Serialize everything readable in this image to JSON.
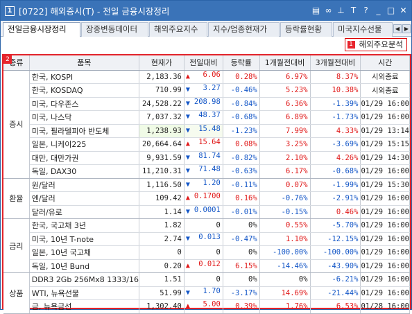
{
  "window": {
    "number": "1",
    "title": "[0722] 해외증시(T) - 전일 금융시장정리",
    "icons": [
      "window-list-icon",
      "link-icon",
      "pin-icon",
      "text-size-icon",
      "help-icon",
      "minimize-icon",
      "maximize-icon",
      "close-icon"
    ],
    "icon_glyphs": [
      "▤",
      "∞",
      "⊥",
      "T",
      "?",
      "_",
      "□",
      "✕"
    ]
  },
  "tabs": [
    {
      "label": "전일금융시장정리",
      "active": true
    },
    {
      "label": "장중변동데이터",
      "active": false
    },
    {
      "label": "해외주요지수",
      "active": false
    },
    {
      "label": "지수/업종현재가",
      "active": false
    },
    {
      "label": "등락률현황",
      "active": false
    },
    {
      "label": "미국지수선물",
      "active": false
    }
  ],
  "tab_arrows": {
    "left": "◀",
    "right": "▶"
  },
  "analysis_button": {
    "badge": "1",
    "label": "해외주요분석"
  },
  "grid_badge": "2",
  "columns": [
    "종류",
    "품목",
    "현재가",
    "전일대비",
    "등락률",
    "1개월전대비",
    "3개월전대비",
    "시간"
  ],
  "colors": {
    "up": "#e01818",
    "down": "#1356c7",
    "title_bar": "#3a73b8",
    "highlight_border": "#e2232b"
  },
  "groups": [
    {
      "category": "증시",
      "rows": [
        {
          "name": "한국, KOSPI",
          "price": "2,183.36",
          "dir": "up",
          "change": "6.06",
          "rate": "0.28%",
          "rate_dir": "up",
          "m1": "6.97%",
          "m1_dir": "up",
          "m3": "8.37%",
          "m3_dir": "up",
          "time": "시외종료"
        },
        {
          "name": "한국, KOSDAQ",
          "price": "710.99",
          "dir": "dn",
          "change": "3.27",
          "rate": "-0.46%",
          "rate_dir": "dn",
          "m1": "5.23%",
          "m1_dir": "up",
          "m3": "10.38%",
          "m3_dir": "up",
          "time": "시외종료"
        },
        {
          "name": "미국, 다우존스",
          "price": "24,528.22",
          "dir": "dn",
          "change": "208.98",
          "rate": "-0.84%",
          "rate_dir": "dn",
          "m1": "6.36%",
          "m1_dir": "up",
          "m3": "-1.39%",
          "m3_dir": "dn",
          "time": "01/29 16:00"
        },
        {
          "name": "미국, 나스닥",
          "price": "7,037.32",
          "dir": "dn",
          "change": "48.37",
          "rate": "-0.68%",
          "rate_dir": "dn",
          "m1": "6.89%",
          "m1_dir": "up",
          "m3": "-1.73%",
          "m3_dir": "dn",
          "time": "01/29 16:00"
        },
        {
          "name": "미국, 필라델피아 반도체",
          "price": "1,238.93",
          "dir": "dn",
          "change": "15.48",
          "rate": "-1.23%",
          "rate_dir": "dn",
          "m1": "7.99%",
          "m1_dir": "up",
          "m3": "4.33%",
          "m3_dir": "up",
          "time": "01/29 13:14",
          "highlight": true
        },
        {
          "name": "일본, 니케이225",
          "price": "20,664.64",
          "dir": "up",
          "change": "15.64",
          "rate": "0.08%",
          "rate_dir": "up",
          "m1": "3.25%",
          "m1_dir": "up",
          "m3": "-3.69%",
          "m3_dir": "dn",
          "time": "01/29 15:15"
        },
        {
          "name": "대만, 대만가권",
          "price": "9,931.59",
          "dir": "dn",
          "change": "81.74",
          "rate": "-0.82%",
          "rate_dir": "dn",
          "m1": "2.10%",
          "m1_dir": "up",
          "m3": "4.26%",
          "m3_dir": "up",
          "time": "01/29 14:30"
        },
        {
          "name": "독일, DAX30",
          "price": "11,210.31",
          "dir": "dn",
          "change": "71.48",
          "rate": "-0.63%",
          "rate_dir": "dn",
          "m1": "6.17%",
          "m1_dir": "up",
          "m3": "-0.68%",
          "m3_dir": "dn",
          "time": "01/29 16:00"
        }
      ]
    },
    {
      "category": "환율",
      "rows": [
        {
          "name": "원/달러",
          "price": "1,116.50",
          "dir": "dn",
          "change": "1.20",
          "rate": "-0.11%",
          "rate_dir": "dn",
          "m1": "0.07%",
          "m1_dir": "up",
          "m3": "-1.99%",
          "m3_dir": "dn",
          "time": "01/29 15:30"
        },
        {
          "name": "엔/달러",
          "price": "109.42",
          "dir": "up",
          "change": "0.1700",
          "rate": "0.16%",
          "rate_dir": "up",
          "m1": "-0.76%",
          "m1_dir": "dn",
          "m3": "-2.91%",
          "m3_dir": "dn",
          "time": "01/29 16:00"
        },
        {
          "name": "달러/유로",
          "price": "1.14",
          "dir": "dn",
          "change": "0.0001",
          "rate": "-0.01%",
          "rate_dir": "dn",
          "m1": "-0.15%",
          "m1_dir": "dn",
          "m3": "0.46%",
          "m3_dir": "up",
          "time": "01/29 16:00"
        }
      ]
    },
    {
      "category": "금리",
      "rows": [
        {
          "name": "한국, 국고채 3년",
          "price": "1.82",
          "dir": "none",
          "change": "0",
          "rate": "0%",
          "rate_dir": "none",
          "m1": "0.55%",
          "m1_dir": "up",
          "m3": "-5.70%",
          "m3_dir": "dn",
          "time": "01/29 16:00"
        },
        {
          "name": "미국, 10년 T-note",
          "price": "2.74",
          "dir": "dn",
          "change": "0.013",
          "rate": "-0.47%",
          "rate_dir": "dn",
          "m1": "1.10%",
          "m1_dir": "up",
          "m3": "-12.15%",
          "m3_dir": "dn",
          "time": "01/29 16:00"
        },
        {
          "name": "일본, 10년 국고채",
          "price": "0",
          "dir": "none",
          "change": "0",
          "rate": "0%",
          "rate_dir": "none",
          "m1": "-100.00%",
          "m1_dir": "dn",
          "m3": "-100.00%",
          "m3_dir": "dn",
          "time": "01/29 16:00"
        },
        {
          "name": "독일, 10년 Bund",
          "price": "0.20",
          "dir": "up",
          "change": "0.012",
          "rate": "6.15%",
          "rate_dir": "up",
          "m1": "-14.46%",
          "m1_dir": "dn",
          "m3": "-43.90%",
          "m3_dir": "dn",
          "time": "01/29 16:00"
        }
      ]
    },
    {
      "category": "상품",
      "rows": [
        {
          "name": "DDR3 2Gb 256Mx8 1333/16",
          "price": "1.51",
          "dir": "none",
          "change": "0",
          "rate": "0%",
          "rate_dir": "none",
          "m1": "0%",
          "m1_dir": "none",
          "m3": "-6.21%",
          "m3_dir": "dn",
          "time": "01/29 16:00"
        },
        {
          "name": "WTI, 뉴욕선물",
          "price": "51.99",
          "dir": "dn",
          "change": "1.70",
          "rate": "-3.17%",
          "rate_dir": "dn",
          "m1": "14.69%",
          "m1_dir": "up",
          "m3": "-21.44%",
          "m3_dir": "dn",
          "time": "01/29 16:00"
        },
        {
          "name": "금, 뉴욕금선",
          "price": "1,302.40",
          "dir": "up",
          "change": "5.00",
          "rate": "0.39%",
          "rate_dir": "up",
          "m1": "1.76%",
          "m1_dir": "up",
          "m3": "6.53%",
          "m3_dir": "up",
          "time": "01/28 16:00"
        }
      ]
    }
  ]
}
